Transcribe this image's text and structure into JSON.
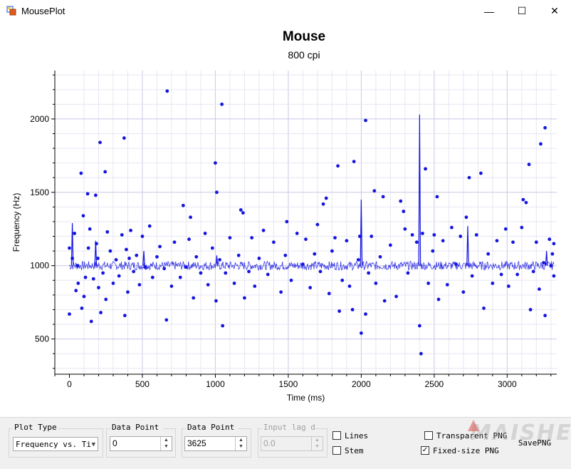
{
  "window": {
    "title": "MousePlot",
    "minimize_glyph": "—",
    "maximize_glyph": "☐",
    "close_glyph": "✕"
  },
  "controls": {
    "plot_type": {
      "label": "Plot Type",
      "value": "Frequency vs. Ti"
    },
    "data_point_start": {
      "label": "Data Point Start",
      "value": "0"
    },
    "data_point_end": {
      "label": "Data Point End",
      "value": "3625"
    },
    "input_lag": {
      "label": "Input lag delay",
      "value": "0.0"
    },
    "lines": {
      "label": "Lines",
      "checked": false
    },
    "stem": {
      "label": "Stem",
      "checked": false
    },
    "transparent_png": {
      "label": "Transparent PNG",
      "checked": false
    },
    "fixed_size_png": {
      "label": "Fixed-size PNG",
      "checked": true
    },
    "save_png": "SavePNG"
  },
  "watermark": "MAISHE",
  "colors": {
    "series": "#1515e0",
    "grid": "#dcdcf0"
  },
  "chart_data": {
    "type": "scatter",
    "title": "Mouse",
    "subtitle": "800 cpi",
    "xlabel": "Time (ms)",
    "ylabel": "Frequency (Hz)",
    "xlim": [
      -100,
      3340
    ],
    "ylim": [
      260,
      2330
    ],
    "xticks": [
      0,
      500,
      1000,
      1500,
      2000,
      2500,
      3000
    ],
    "yticks": [
      500,
      1000,
      1500,
      2000
    ],
    "grid": true,
    "baseline": 1000,
    "series": [
      {
        "points": [
          [
            0,
            670
          ],
          [
            0,
            1120
          ],
          [
            20,
            1050
          ],
          [
            35,
            1220
          ],
          [
            45,
            830
          ],
          [
            55,
            1000
          ],
          [
            60,
            880
          ],
          [
            80,
            1630
          ],
          [
            85,
            710
          ],
          [
            95,
            1340
          ],
          [
            100,
            790
          ],
          [
            110,
            920
          ],
          [
            125,
            1490
          ],
          [
            130,
            1120
          ],
          [
            140,
            1250
          ],
          [
            150,
            620
          ],
          [
            165,
            910
          ],
          [
            180,
            1480
          ],
          [
            185,
            1150
          ],
          [
            195,
            1050
          ],
          [
            200,
            850
          ],
          [
            210,
            1840
          ],
          [
            215,
            680
          ],
          [
            230,
            950
          ],
          [
            245,
            1640
          ],
          [
            250,
            770
          ],
          [
            260,
            1230
          ],
          [
            280,
            1100
          ],
          [
            300,
            880
          ],
          [
            320,
            1040
          ],
          [
            340,
            930
          ],
          [
            360,
            1210
          ],
          [
            375,
            1870
          ],
          [
            380,
            660
          ],
          [
            390,
            1110
          ],
          [
            400,
            820
          ],
          [
            410,
            1050
          ],
          [
            420,
            1240
          ],
          [
            440,
            960
          ],
          [
            460,
            1070
          ],
          [
            480,
            870
          ],
          [
            500,
            1200
          ],
          [
            520,
            990
          ],
          [
            550,
            1270
          ],
          [
            570,
            920
          ],
          [
            600,
            1060
          ],
          [
            620,
            1130
          ],
          [
            650,
            980
          ],
          [
            665,
            630
          ],
          [
            670,
            2190
          ],
          [
            700,
            860
          ],
          [
            720,
            1160
          ],
          [
            760,
            920
          ],
          [
            780,
            1410
          ],
          [
            800,
            990
          ],
          [
            820,
            1180
          ],
          [
            830,
            1330
          ],
          [
            850,
            780
          ],
          [
            870,
            1060
          ],
          [
            900,
            950
          ],
          [
            930,
            1220
          ],
          [
            950,
            870
          ],
          [
            980,
            1120
          ],
          [
            1000,
            1700
          ],
          [
            1005,
            760
          ],
          [
            1010,
            1500
          ],
          [
            1030,
            1040
          ],
          [
            1045,
            2100
          ],
          [
            1050,
            590
          ],
          [
            1070,
            950
          ],
          [
            1100,
            1190
          ],
          [
            1130,
            880
          ],
          [
            1160,
            1070
          ],
          [
            1175,
            1380
          ],
          [
            1190,
            1360
          ],
          [
            1200,
            780
          ],
          [
            1230,
            960
          ],
          [
            1250,
            1190
          ],
          [
            1270,
            860
          ],
          [
            1300,
            1050
          ],
          [
            1330,
            1240
          ],
          [
            1360,
            940
          ],
          [
            1400,
            1160
          ],
          [
            1450,
            820
          ],
          [
            1480,
            1070
          ],
          [
            1490,
            1300
          ],
          [
            1520,
            900
          ],
          [
            1560,
            1220
          ],
          [
            1600,
            1010
          ],
          [
            1620,
            1180
          ],
          [
            1650,
            850
          ],
          [
            1680,
            1080
          ],
          [
            1700,
            1280
          ],
          [
            1720,
            960
          ],
          [
            1740,
            1420
          ],
          [
            1760,
            1460
          ],
          [
            1780,
            810
          ],
          [
            1800,
            1100
          ],
          [
            1820,
            1190
          ],
          [
            1840,
            1680
          ],
          [
            1850,
            690
          ],
          [
            1870,
            900
          ],
          [
            1900,
            1170
          ],
          [
            1920,
            860
          ],
          [
            1940,
            700
          ],
          [
            1950,
            1710
          ],
          [
            1980,
            1040
          ],
          [
            1990,
            1200
          ],
          [
            2000,
            540
          ],
          [
            2030,
            1990
          ],
          [
            2030,
            670
          ],
          [
            2050,
            950
          ],
          [
            2070,
            1200
          ],
          [
            2090,
            1510
          ],
          [
            2100,
            880
          ],
          [
            2130,
            1060
          ],
          [
            2150,
            1470
          ],
          [
            2160,
            760
          ],
          [
            2200,
            1140
          ],
          [
            2240,
            790
          ],
          [
            2270,
            1440
          ],
          [
            2290,
            1370
          ],
          [
            2300,
            1250
          ],
          [
            2320,
            950
          ],
          [
            2350,
            1210
          ],
          [
            2380,
            1160
          ],
          [
            2400,
            590
          ],
          [
            2410,
            400
          ],
          [
            2420,
            1220
          ],
          [
            2440,
            1660
          ],
          [
            2460,
            880
          ],
          [
            2490,
            1100
          ],
          [
            2500,
            1210
          ],
          [
            2520,
            1470
          ],
          [
            2530,
            770
          ],
          [
            2560,
            1170
          ],
          [
            2590,
            870
          ],
          [
            2620,
            1260
          ],
          [
            2650,
            1010
          ],
          [
            2680,
            1200
          ],
          [
            2700,
            820
          ],
          [
            2720,
            1330
          ],
          [
            2740,
            1600
          ],
          [
            2760,
            930
          ],
          [
            2790,
            1210
          ],
          [
            2820,
            1630
          ],
          [
            2840,
            710
          ],
          [
            2870,
            1080
          ],
          [
            2900,
            880
          ],
          [
            2930,
            1170
          ],
          [
            2960,
            940
          ],
          [
            2990,
            1250
          ],
          [
            3010,
            860
          ],
          [
            3040,
            1160
          ],
          [
            3070,
            940
          ],
          [
            3100,
            1260
          ],
          [
            3110,
            1450
          ],
          [
            3130,
            1430
          ],
          [
            3150,
            1690
          ],
          [
            3160,
            700
          ],
          [
            3180,
            960
          ],
          [
            3200,
            1160
          ],
          [
            3220,
            840
          ],
          [
            3230,
            1830
          ],
          [
            3250,
            1020
          ],
          [
            3260,
            1940
          ],
          [
            3260,
            660
          ],
          [
            3290,
            1180
          ],
          [
            3300,
            1000
          ],
          [
            3310,
            1080
          ],
          [
            3320,
            930
          ],
          [
            3320,
            1150
          ]
        ]
      }
    ],
    "spikes": [
      [
        20,
        1290
      ],
      [
        180,
        1170
      ],
      [
        510,
        1100
      ],
      [
        1010,
        1070
      ],
      [
        2000,
        1450
      ],
      [
        2400,
        2030
      ],
      [
        2730,
        1270
      ],
      [
        3270,
        1100
      ]
    ]
  }
}
